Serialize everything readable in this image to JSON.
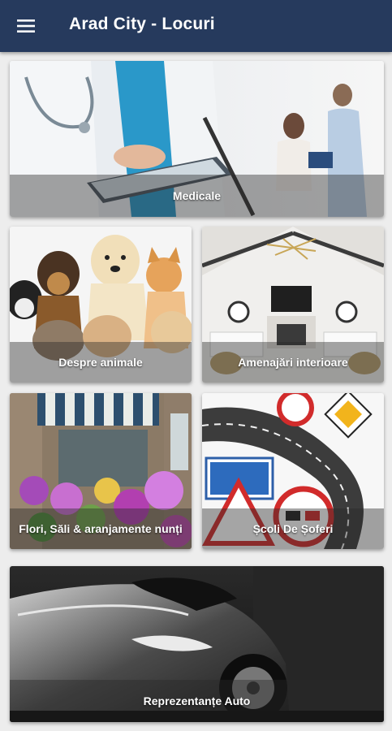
{
  "appbar": {
    "title": "Arad City - Locuri",
    "menu_icon": "hamburger-menu-icon"
  },
  "categories": [
    {
      "label": "Medicale",
      "image": "doctors-with-tablet-image"
    },
    {
      "label": "Despre animale",
      "image": "pets-group-image"
    },
    {
      "label": "Amenajări interioare",
      "image": "living-room-interior-image"
    },
    {
      "label": "Flori, Săli & aranjamente nunți",
      "image": "flower-shop-storefront-image"
    },
    {
      "label": "Școli De Șoferi",
      "image": "road-signs-image"
    },
    {
      "label": "Reprezentanțe Auto",
      "image": "sports-car-image"
    }
  ]
}
